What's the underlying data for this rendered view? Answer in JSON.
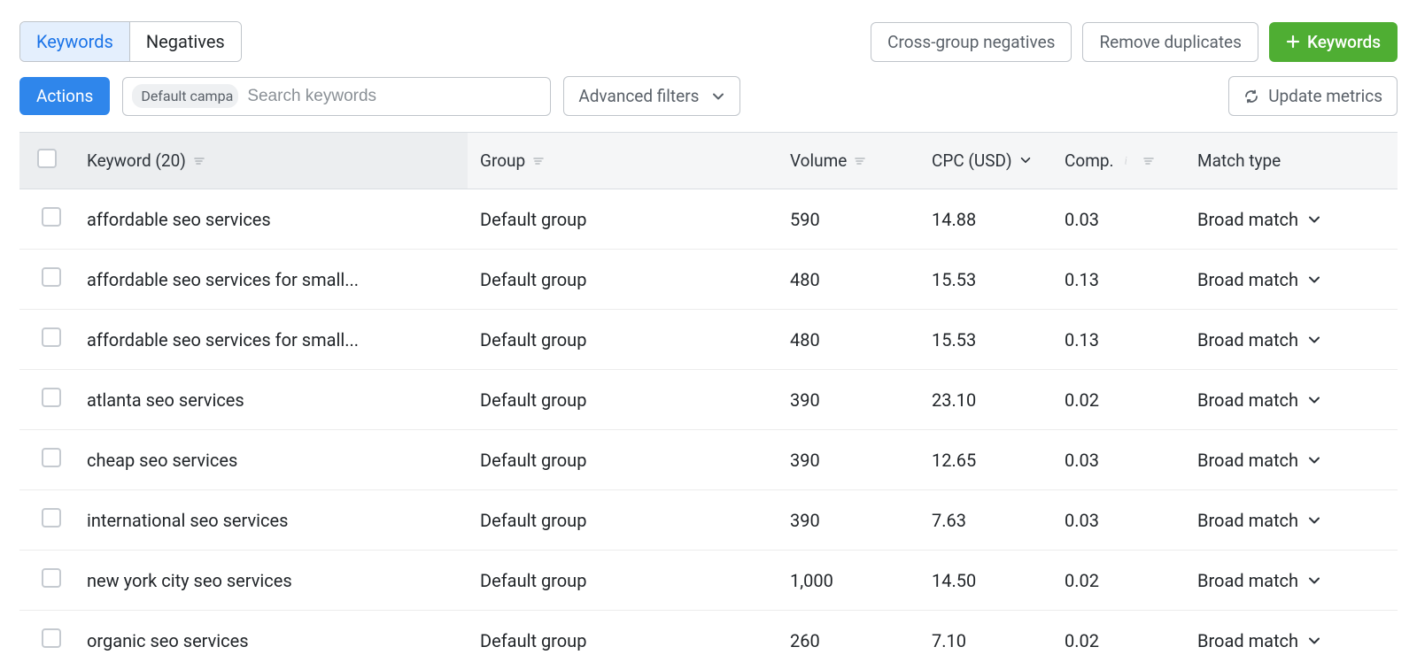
{
  "tabs": {
    "keywords": "Keywords",
    "negatives": "Negatives"
  },
  "topButtons": {
    "crossGroup": "Cross-group negatives",
    "removeDup": "Remove duplicates",
    "addKeywords": "Keywords"
  },
  "filters": {
    "actions": "Actions",
    "chip": "Default campa",
    "searchPlaceholder": "Search keywords",
    "advanced": "Advanced filters",
    "update": "Update metrics"
  },
  "columns": {
    "keyword": "Keyword (20)",
    "group": "Group",
    "volume": "Volume",
    "cpc": "CPC (USD)",
    "comp": "Comp.",
    "match": "Match type"
  },
  "rows": [
    {
      "keyword": "affordable seo services",
      "group": "Default group",
      "volume": "590",
      "cpc": "14.88",
      "comp": "0.03",
      "match": "Broad match"
    },
    {
      "keyword": "affordable seo services for small...",
      "group": "Default group",
      "volume": "480",
      "cpc": "15.53",
      "comp": "0.13",
      "match": "Broad match"
    },
    {
      "keyword": "affordable seo services for small...",
      "group": "Default group",
      "volume": "480",
      "cpc": "15.53",
      "comp": "0.13",
      "match": "Broad match"
    },
    {
      "keyword": "atlanta seo services",
      "group": "Default group",
      "volume": "390",
      "cpc": "23.10",
      "comp": "0.02",
      "match": "Broad match"
    },
    {
      "keyword": "cheap seo services",
      "group": "Default group",
      "volume": "390",
      "cpc": "12.65",
      "comp": "0.03",
      "match": "Broad match"
    },
    {
      "keyword": "international seo services",
      "group": "Default group",
      "volume": "390",
      "cpc": "7.63",
      "comp": "0.03",
      "match": "Broad match"
    },
    {
      "keyword": "new york city seo services",
      "group": "Default group",
      "volume": "1,000",
      "cpc": "14.50",
      "comp": "0.02",
      "match": "Broad match"
    },
    {
      "keyword": "organic seo services",
      "group": "Default group",
      "volume": "260",
      "cpc": "7.10",
      "comp": "0.02",
      "match": "Broad match"
    }
  ]
}
